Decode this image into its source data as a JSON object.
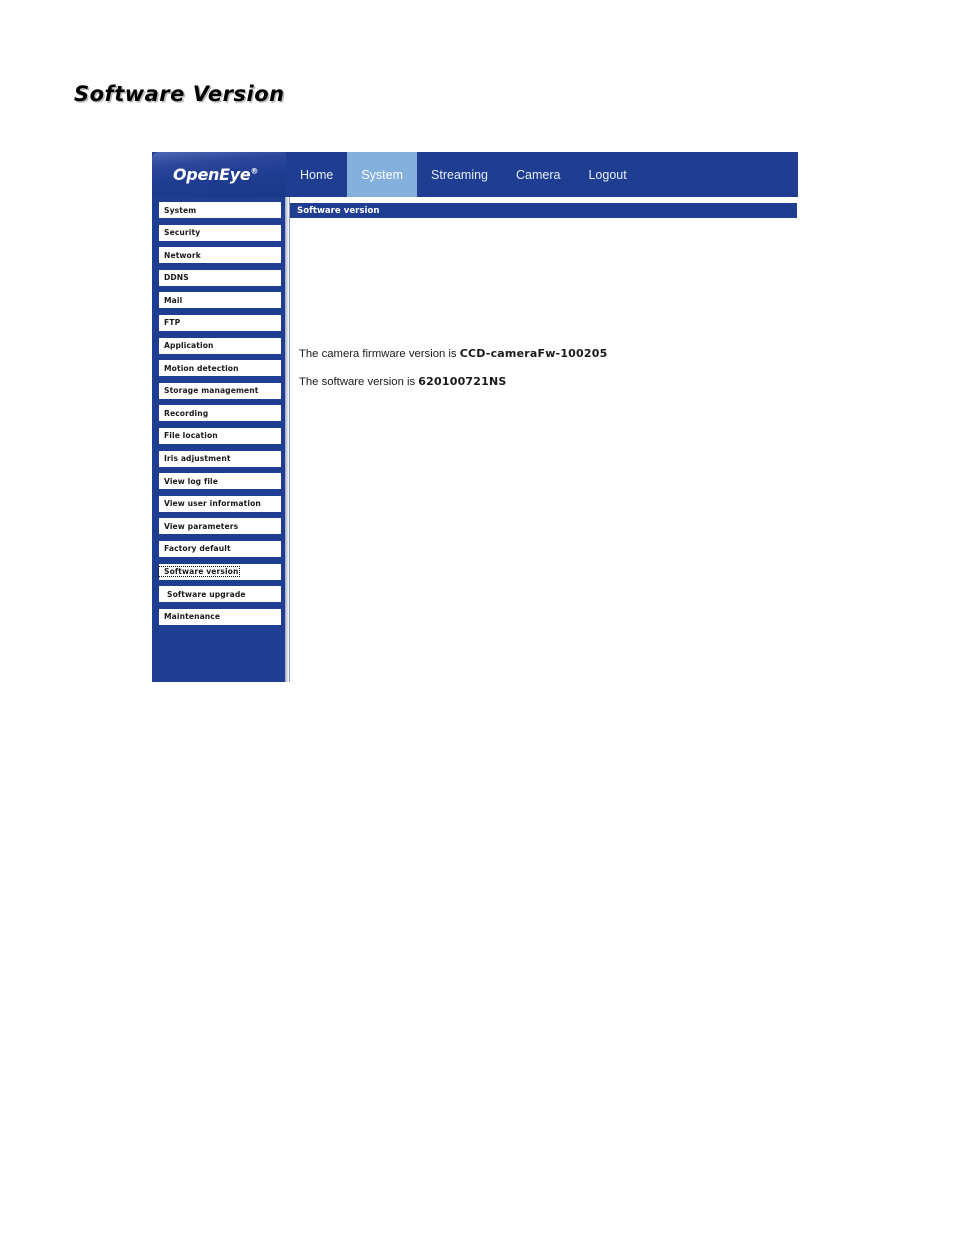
{
  "page": {
    "title": "Software Version"
  },
  "header": {
    "logo": "OpenEye",
    "logo_trademark": "®",
    "nav": [
      {
        "label": "Home",
        "active": false
      },
      {
        "label": "System",
        "active": true
      },
      {
        "label": "Streaming",
        "active": false
      },
      {
        "label": "Camera",
        "active": false
      },
      {
        "label": "Logout",
        "active": false
      }
    ]
  },
  "sidebar": {
    "items": [
      {
        "label": "System",
        "selected": false,
        "indented": false
      },
      {
        "label": "Security",
        "selected": false,
        "indented": false
      },
      {
        "label": "Network",
        "selected": false,
        "indented": false
      },
      {
        "label": "DDNS",
        "selected": false,
        "indented": false
      },
      {
        "label": "Mail",
        "selected": false,
        "indented": false
      },
      {
        "label": "FTP",
        "selected": false,
        "indented": false
      },
      {
        "label": "Application",
        "selected": false,
        "indented": false
      },
      {
        "label": "Motion detection",
        "selected": false,
        "indented": false
      },
      {
        "label": "Storage management",
        "selected": false,
        "indented": false
      },
      {
        "label": "Recording",
        "selected": false,
        "indented": false
      },
      {
        "label": "File location",
        "selected": false,
        "indented": false
      },
      {
        "label": "Iris adjustment",
        "selected": false,
        "indented": false
      },
      {
        "label": "View log file",
        "selected": false,
        "indented": false
      },
      {
        "label": "View user information",
        "selected": false,
        "indented": false
      },
      {
        "label": "View parameters",
        "selected": false,
        "indented": false
      },
      {
        "label": "Factory default",
        "selected": false,
        "indented": false
      },
      {
        "label": "Software version",
        "selected": true,
        "indented": false
      },
      {
        "label": "Software upgrade",
        "selected": false,
        "indented": true
      },
      {
        "label": "Maintenance",
        "selected": false,
        "indented": false
      }
    ]
  },
  "content": {
    "header_label": "Software version",
    "lines": [
      {
        "prefix": "The camera firmware version is ",
        "value": "CCD-cameraFw-100205"
      },
      {
        "prefix": "The software version is ",
        "value": "620100721NS"
      }
    ]
  },
  "colors": {
    "brand_blue": "#1f3d91",
    "active_tab": "#84b0de",
    "text_dark": "#1a1a1a",
    "white": "#ffffff"
  }
}
